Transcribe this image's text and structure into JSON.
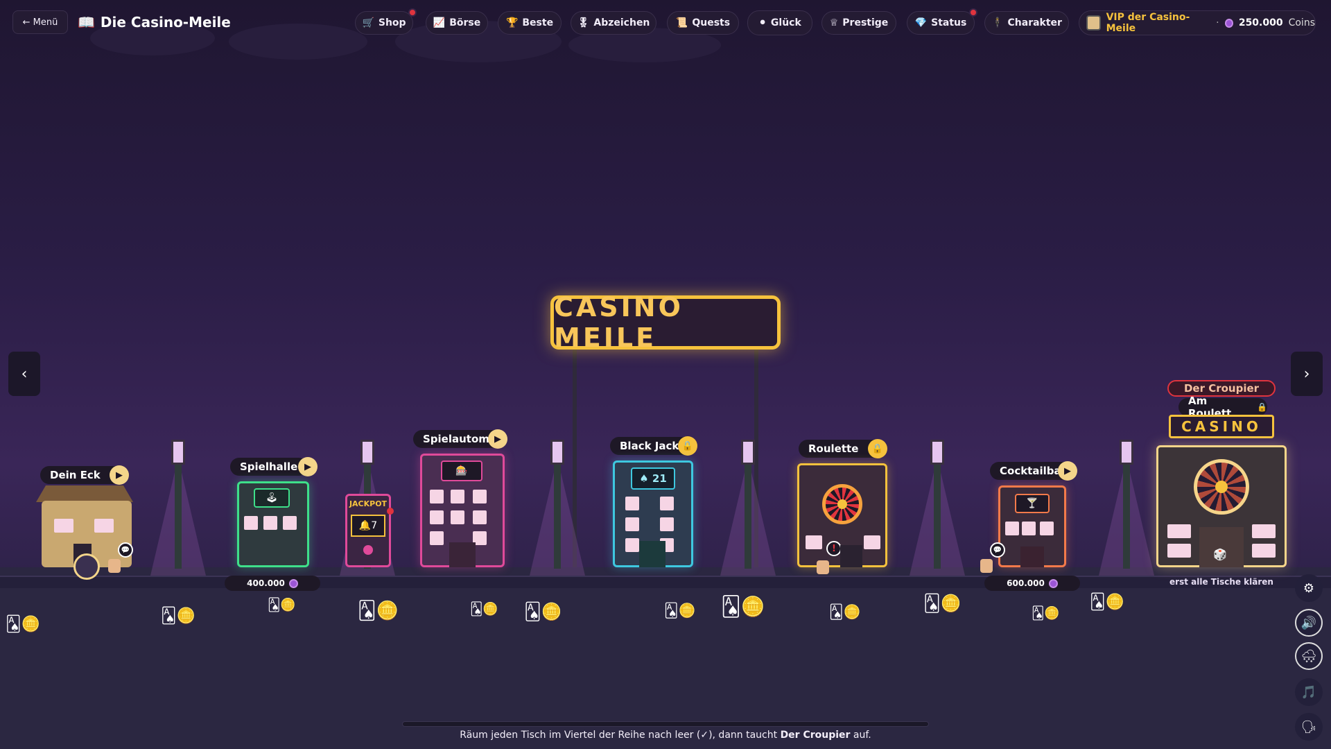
{
  "topbar": {
    "menu_label": "← Menü",
    "title_icon": "📖",
    "title": "Die Casino-Meile",
    "nav": [
      {
        "icon": "🛒",
        "label": "Shop",
        "alert": true
      },
      {
        "icon": "📈",
        "label": "Börse",
        "alert": false
      },
      {
        "icon": "🏆",
        "label": "Beste",
        "alert": false
      },
      {
        "icon": "🎖",
        "label": "Abzeichen",
        "alert": false
      },
      {
        "icon": "📜",
        "label": "Quests",
        "alert": false
      },
      {
        "icon": "⚫",
        "label": "Glück",
        "alert": false
      },
      {
        "icon": "♕",
        "label": "Prestige",
        "alert": false
      },
      {
        "icon": "💎",
        "label": "Status",
        "alert": true
      },
      {
        "icon": "🕴",
        "label": "Charakter",
        "alert": false
      }
    ],
    "rank": "VIP der Casino-Meile",
    "separator": "·",
    "coins_value": "250.000",
    "coins_unit": "Coins"
  },
  "sign": "CASINO MEILE",
  "buildings": [
    {
      "label": "Dein Eck",
      "state": "play"
    },
    {
      "label": "Spielhalle",
      "state": "play",
      "price": "400.000"
    },
    {
      "label": "JACKPOT",
      "state": "none"
    },
    {
      "label": "Spielautomat",
      "state": "play"
    },
    {
      "label": "Black Jack",
      "state": "locked",
      "screen": "♠ 21"
    },
    {
      "label": "Roulette",
      "state": "locked"
    },
    {
      "label": "Cocktailba",
      "state": "play",
      "price": "600.000"
    }
  ],
  "boss": {
    "tag": "Der Croupier",
    "subtitle": "Am Roulett",
    "sign": "CASINO",
    "note": "erst alle Tische klären"
  },
  "hint": {
    "pre": "Räum jeden Tisch im Viertel der Reihe nach leer (✓), dann taucht ",
    "bold": "Der Croupier",
    "post": " auf."
  },
  "colors": {
    "accent": "#f6c23d",
    "coin": "#9c55d6",
    "alert": "#e0343e"
  },
  "icons": [
    "settings-icon",
    "sound-icon",
    "weather-icon",
    "music-icon",
    "voice-icon"
  ]
}
